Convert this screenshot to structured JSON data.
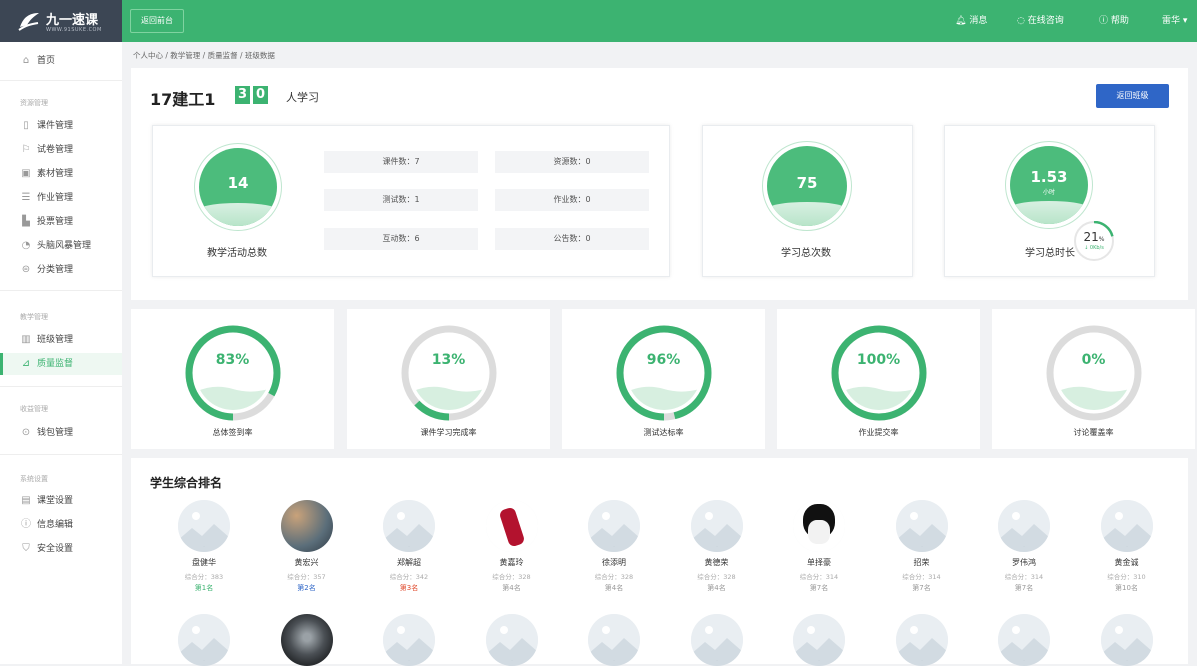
{
  "brand": {
    "name": "九一速课",
    "sub": "WWW.91SUKE.COM"
  },
  "topbar": {
    "back_label": "返回前台",
    "messages": "消息",
    "online": "在线咨询",
    "help": "帮助",
    "user": "雷华"
  },
  "sidebar": {
    "home": "首页",
    "sec_resource": "资源管理",
    "resource_items": [
      "课件管理",
      "试卷管理",
      "素材管理",
      "作业管理",
      "投票管理",
      "头脑风暴管理",
      "分类管理"
    ],
    "sec_teaching": "教学管理",
    "teaching_items": [
      "班级管理",
      "质量监督"
    ],
    "sec_income": "收益管理",
    "income_items": [
      "钱包管理"
    ],
    "sec_system": "系统设置",
    "system_items": [
      "课堂设置",
      "信息编辑",
      "安全设置"
    ]
  },
  "breadcrumb": "个人中心 / 教学管理 / 质量监督 / 班级数据",
  "header": {
    "class_name": "17建工1",
    "digit1": "3",
    "digit2": "0",
    "learn_text": "人学习",
    "return_button": "返回班级"
  },
  "activity": {
    "total": "14",
    "caption": "教学活动总数",
    "stats": [
      "课件数：7",
      "资源数：0",
      "测试数：1",
      "作业数：0",
      "互动数：6",
      "公告数：0"
    ]
  },
  "study_count": {
    "value": "75",
    "caption": "学习总次数"
  },
  "study_time": {
    "value": "1.53",
    "unit": "小时",
    "caption": "学习总时长",
    "badge": "21",
    "badge_unit": "%",
    "badge_sub": "↓ 0Kb/s"
  },
  "rings": [
    {
      "label": "总体签到率",
      "value": "83%",
      "fraction": 0.83
    },
    {
      "label": "课件学习完成率",
      "value": "13%",
      "fraction": 0.13
    },
    {
      "label": "测试达标率",
      "value": "96%",
      "fraction": 0.96
    },
    {
      "label": "作业提交率",
      "value": "100%",
      "fraction": 1.0
    },
    {
      "label": "讨论覆盖率",
      "value": "0%",
      "fraction": 0.0
    }
  ],
  "ranking": {
    "title": "学生综合排名",
    "students": [
      {
        "name": "盘健华",
        "score": "综合分：383",
        "rank": "第1名",
        "rank_color": "#3cb371"
      },
      {
        "name": "黄宏兴",
        "score": "综合分：357",
        "rank": "第2名",
        "rank_color": "#2f66c7"
      },
      {
        "name": "郑解超",
        "score": "综合分：342",
        "rank": "第3名",
        "rank_color": "#e04b2e"
      },
      {
        "name": "黄嘉玲",
        "score": "综合分：328",
        "rank": "第4名",
        "rank_color": "#999999"
      },
      {
        "name": "徐添明",
        "score": "综合分：328",
        "rank": "第4名",
        "rank_color": "#999999"
      },
      {
        "name": "黄德荣",
        "score": "综合分：328",
        "rank": "第4名",
        "rank_color": "#999999"
      },
      {
        "name": "单择豪",
        "score": "综合分：314",
        "rank": "第7名",
        "rank_color": "#999999"
      },
      {
        "name": "招荣",
        "score": "综合分：314",
        "rank": "第7名",
        "rank_color": "#999999"
      },
      {
        "name": "罗伟鸿",
        "score": "综合分：314",
        "rank": "第7名",
        "rank_color": "#999999"
      },
      {
        "name": "黄金诚",
        "score": "综合分：310",
        "rank": "第10名",
        "rank_color": "#999999"
      }
    ]
  },
  "colors": {
    "accent": "#3cb371",
    "primary_button": "#2f66c7",
    "sidebar_dark": "#3c4654"
  }
}
